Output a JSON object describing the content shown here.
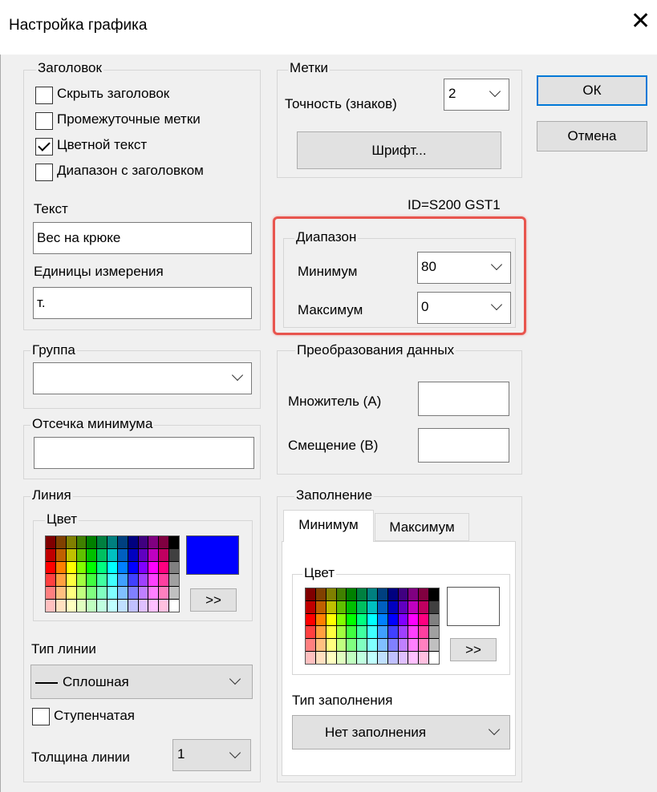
{
  "window": {
    "title": "Настройка графика"
  },
  "buttons": {
    "ok": "ОК",
    "cancel": "Отмена"
  },
  "header_group": {
    "legend": "Заголовок",
    "checkboxes": [
      {
        "label": "Скрыть заголовок",
        "checked": false
      },
      {
        "label": "Промежуточные метки",
        "checked": false
      },
      {
        "label": "Цветной текст",
        "checked": true
      },
      {
        "label": "Диапазон с заголовком",
        "checked": false
      }
    ],
    "text_label": "Текст",
    "text_value": "Вес на крюке",
    "units_label": "Единицы измерения",
    "units_value": "т."
  },
  "labels_group": {
    "legend": "Метки",
    "precision_label": "Точность (знаков)",
    "precision_value": "2",
    "font_button": "Шрифт..."
  },
  "id_text": "ID=S200 GST1",
  "range_group": {
    "legend": "Диапазон",
    "min_label": "Минимум",
    "min_value": "80",
    "max_label": "Максимум",
    "max_value": "0",
    "highlight_color": "#e8554e"
  },
  "group_group": {
    "legend": "Группа",
    "value": ""
  },
  "transform_group": {
    "legend": "Преобразования данных",
    "multiplier_label": "Множитель (А)",
    "multiplier_value": "",
    "offset_label": "Смещение (В)",
    "offset_value": ""
  },
  "min_cutoff_group": {
    "legend": "Отсечка минимума",
    "value": ""
  },
  "line_group": {
    "legend": "Линия",
    "color_legend": "Цвет",
    "selected_color": "#0000ff",
    "more_button": ">>",
    "line_type_label": "Тип линии",
    "line_type_value": "Сплошная",
    "stepped_label": "Ступенчатая",
    "stepped_checked": false,
    "thickness_label": "Толщина линии",
    "thickness_value": "1"
  },
  "fill_group": {
    "legend": "Заполнение",
    "tabs": [
      "Минимум",
      "Максимум"
    ],
    "active_tab": "Минимум",
    "color_legend": "Цвет",
    "selected_color": "#ffffff",
    "more_button": ">>",
    "fill_type_label": "Тип заполнения",
    "fill_type_value": "Нет заполнения"
  },
  "palette": {
    "rows": [
      [
        "#800000",
        "#804000",
        "#808000",
        "#408000",
        "#008000",
        "#008040",
        "#008080",
        "#004080",
        "#000080",
        "#400080",
        "#800080",
        "#800040",
        "#000000"
      ],
      [
        "#c00000",
        "#c06000",
        "#c0c000",
        "#60c000",
        "#00c000",
        "#00c060",
        "#00c0c0",
        "#0060c0",
        "#0000c0",
        "#6000c0",
        "#c000c0",
        "#c00060",
        "#404040"
      ],
      [
        "#ff0000",
        "#ff8000",
        "#ffff00",
        "#80ff00",
        "#00ff00",
        "#00ff80",
        "#00ffff",
        "#0080ff",
        "#0000ff",
        "#8000ff",
        "#ff00ff",
        "#ff0080",
        "#808080"
      ],
      [
        "#ff4040",
        "#ffa040",
        "#ffff40",
        "#a0ff40",
        "#40ff40",
        "#40ffa0",
        "#40ffff",
        "#40a0ff",
        "#4040ff",
        "#a040ff",
        "#ff40ff",
        "#ff40a0",
        "#a0a0a0"
      ],
      [
        "#ff8080",
        "#ffc080",
        "#ffff80",
        "#c0ff80",
        "#80ff80",
        "#80ffc0",
        "#80ffff",
        "#80c0ff",
        "#8080ff",
        "#c080ff",
        "#ff80ff",
        "#ff80c0",
        "#c0c0c0"
      ],
      [
        "#ffc0c0",
        "#ffe0c0",
        "#ffffc0",
        "#e0ffc0",
        "#c0ffc0",
        "#c0ffe0",
        "#c0ffff",
        "#c0e0ff",
        "#c0c0ff",
        "#e0c0ff",
        "#ffc0ff",
        "#ffc0e0",
        "#ffffff"
      ]
    ]
  }
}
